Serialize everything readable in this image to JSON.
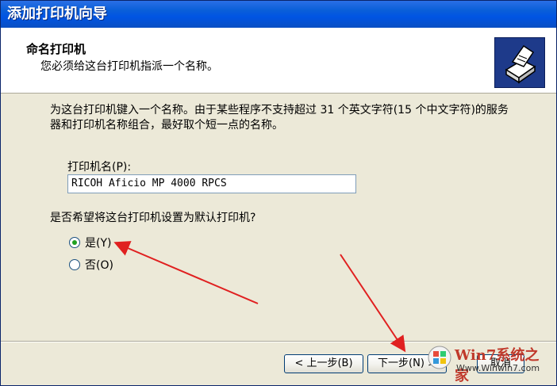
{
  "window": {
    "title": "添加打印机向导"
  },
  "header": {
    "title": "命名打印机",
    "subtitle": "您必须给这台打印机指派一个名称。",
    "icon": "printer-icon"
  },
  "main": {
    "description": "为这台打印机键入一个名称。由于某些程序不支持超过 31 个英文字符(15 个中文字符)的服务器和打印机名称组合，最好取个短一点的名称。",
    "printer_name_label": "打印机名(P):",
    "printer_name_value": "RICOH Aficio MP 4000 RPCS",
    "default_question": "是否希望将这台打印机设置为默认打印机?",
    "options": [
      {
        "label": "是(Y)",
        "checked": true
      },
      {
        "label": "否(O)",
        "checked": false
      }
    ]
  },
  "buttons": {
    "back": "< 上一步(B)",
    "next": "下一步(N) >",
    "cancel": "取消"
  },
  "watermark": {
    "brand": "Win7系统之家",
    "url": "Www.Winwin7.com"
  },
  "colors": {
    "titlebar": "#0054e3",
    "dialog_bg": "#ece9d8",
    "arrow": "#e02020"
  }
}
